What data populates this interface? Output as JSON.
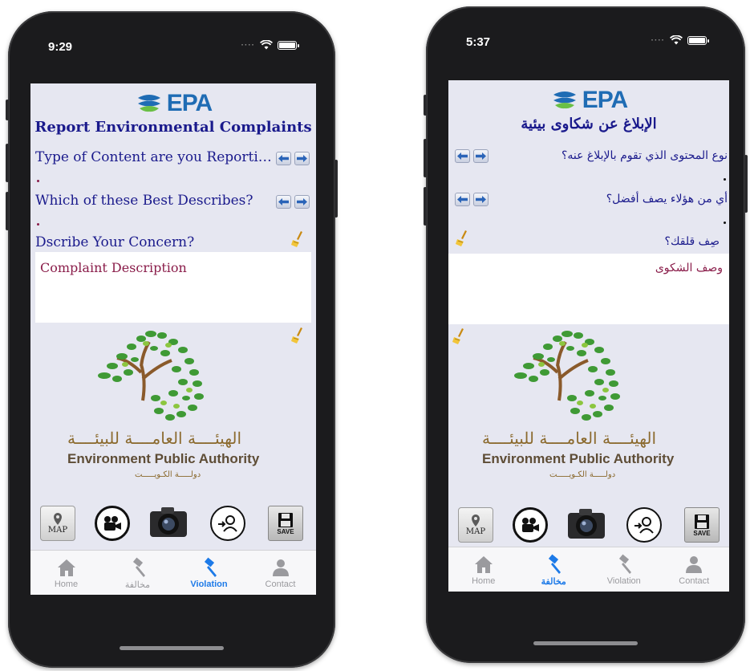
{
  "colors": {
    "title_blue": "#1a1a8c",
    "placeholder_maroon": "#8a1d4a",
    "tab_active": "#1d7ae8",
    "tab_inactive": "#9a9a9e",
    "screen_bg": "#e6e7f1",
    "epa_blue": "#1f6cb4"
  },
  "phones": [
    {
      "status_time": "9:29",
      "logo_text": "EPA",
      "title": "Report Environmental Complaints",
      "question_type": "Type of Content are you Reporti…",
      "question_describe": "Which of these Best Describes?",
      "question_concern": "Dscribe Your Concern?",
      "description_placeholder": "Complaint Description",
      "authority_ar": "الهيئــــة العامــــة للبيئــــة",
      "authority_en": "Environment Public Authority",
      "authority_ar_sub": "دولـــــة الكـويـــــت",
      "map_label": "MAP",
      "save_label": "SAVE",
      "tabs": [
        {
          "label": "Home",
          "icon": "home-icon"
        },
        {
          "label": "مخالفة",
          "icon": "gavel-icon"
        },
        {
          "label": "Violation",
          "icon": "gavel-icon",
          "active": true
        },
        {
          "label": "Contact",
          "icon": "person-icon"
        }
      ]
    },
    {
      "status_time": "5:37",
      "logo_text": "EPA",
      "title": "الإبلاغ عن شكاوى بيئية",
      "question_type": "نوع المحتوى الذي تقوم بالإبلاغ عنه؟",
      "question_describe": "أي من هؤلاء يصف أفضل؟",
      "question_concern": "صِف قلقك؟",
      "description_placeholder": "وصف الشكوى",
      "authority_ar": "الهيئــــة العامــــة للبيئــــة",
      "authority_en": "Environment Public Authority",
      "authority_ar_sub": "دولـــــة الكـويـــــت",
      "map_label": "MAP",
      "save_label": "SAVE",
      "tabs": [
        {
          "label": "Home",
          "icon": "home-icon"
        },
        {
          "label": "مخالفة",
          "icon": "gavel-icon",
          "active": true
        },
        {
          "label": "Violation",
          "icon": "gavel-icon"
        },
        {
          "label": "Contact",
          "icon": "person-icon"
        }
      ]
    }
  ]
}
